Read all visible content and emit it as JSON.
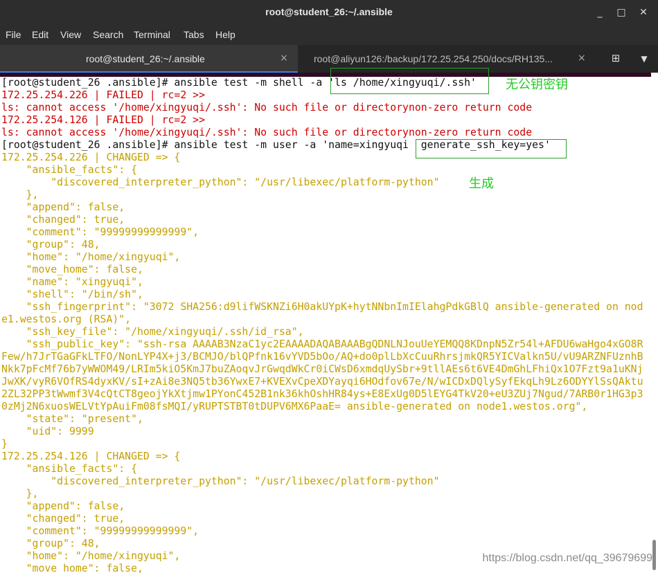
{
  "window": {
    "title": "root@student_26:~/.ansible",
    "minimize_icon": "minimize-icon",
    "maximize_icon": "maximize-icon",
    "close_icon": "close-icon"
  },
  "menu": [
    "File",
    "Edit",
    "View",
    "Search",
    "Terminal",
    "Tabs",
    "Help"
  ],
  "tabs": [
    {
      "label": "root@student_26:~/.ansible",
      "active": true,
      "close": "×"
    },
    {
      "label": "root@aliyun126:/backup/172.25.254.250/docs/RH135...",
      "active": false,
      "close": "×"
    }
  ],
  "tab_actions": {
    "new_tab_icon": "new-tab-icon",
    "menu_icon": "chevron-down-icon"
  },
  "colors": {
    "prompt": "#111111",
    "error": "#cc0000",
    "output": "#c4a000",
    "annotation": "#22cc22",
    "box": "#2e9e2e"
  },
  "terminal": {
    "lines": [
      {
        "t": "[root@student_26 .ansible]# ansible test -m shell -a 'ls /home/xingyuqi/.ssh'",
        "c": "dark"
      },
      {
        "t": "172.25.254.226 | FAILED | rc=2 >>",
        "c": "red"
      },
      {
        "t": "ls: cannot access '/home/xingyuqi/.ssh': No such file or directorynon-zero return code",
        "c": "red"
      },
      {
        "t": "172.25.254.126 | FAILED | rc=2 >>",
        "c": "red"
      },
      {
        "t": "ls: cannot access '/home/xingyuqi/.ssh': No such file or directorynon-zero return code",
        "c": "red"
      },
      {
        "t": "[root@student_26 .ansible]# ansible test -m user -a 'name=xingyuqi  generate_ssh_key=yes'",
        "c": "dark"
      },
      {
        "t": "172.25.254.226 | CHANGED => {",
        "c": "gold"
      },
      {
        "t": "    \"ansible_facts\": {",
        "c": "gold"
      },
      {
        "t": "        \"discovered_interpreter_python\": \"/usr/libexec/platform-python\"",
        "c": "gold"
      },
      {
        "t": "    },",
        "c": "gold"
      },
      {
        "t": "    \"append\": false,",
        "c": "gold"
      },
      {
        "t": "    \"changed\": true,",
        "c": "gold"
      },
      {
        "t": "    \"comment\": \"99999999999999\",",
        "c": "gold"
      },
      {
        "t": "    \"group\": 48,",
        "c": "gold"
      },
      {
        "t": "    \"home\": \"/home/xingyuqi\",",
        "c": "gold"
      },
      {
        "t": "    \"move_home\": false,",
        "c": "gold"
      },
      {
        "t": "    \"name\": \"xingyuqi\",",
        "c": "gold"
      },
      {
        "t": "    \"shell\": \"/bin/sh\",",
        "c": "gold"
      },
      {
        "t": "    \"ssh_fingerprint\": \"3072 SHA256:d9lifWSKNZi6H0akUYpK+hytNNbnImIElahgPdkGBlQ ansible-generated on nod",
        "c": "gold"
      },
      {
        "t": "e1.westos.org (RSA)\",",
        "c": "gold"
      },
      {
        "t": "    \"ssh_key_file\": \"/home/xingyuqi/.ssh/id_rsa\",",
        "c": "gold"
      },
      {
        "t": "    \"ssh_public_key\": \"ssh-rsa AAAAB3NzaC1yc2EAAAADAQABAAABgQDNLNJouUeYEMQQ8KDnpN5Zr54l+AFDU6waHgo4xGO8R",
        "c": "gold"
      },
      {
        "t": "Few/h7JrTGaGFkLTFO/NonLYP4X+j3/BCMJO/blQPfnk16vYVD5bOo/AQ+do0plLbXcCuuRhrsjmkQR5YICValkn5U/vU9ARZNFUznhB",
        "c": "gold"
      },
      {
        "t": "Nkk7pFcMf76b7yWWOM49/LRIm5kiO5KmJ7buZAoqvJrGwqdWkCr0iCWsD6xmdqUySbr+9tllAEs6t6VE4DmGhLFhiQx1O7Fzt9a1uKNj",
        "c": "gold"
      },
      {
        "t": "JwXK/vyR6VOfRS4dyxKV/sI+zAi8e3NQ5tb36YwxE7+KVEXvCpeXDYayqi6HOdfov67e/N/wICDxDQlySyfEkqLh9Lz6ODYYlSsQAktu",
        "c": "gold"
      },
      {
        "t": "2ZL32PP3tWwmf3V4cQtCT8geojYkXtjmw1PYonC452B1nk36khOshHR84ys+E8ExUg0D5lEYG4TkV20+eU3ZUj7Ngud/7ARB0r1HG3p3",
        "c": "gold"
      },
      {
        "t": "0zMj2N6xuosWELVtYpAuiFm08fsMQI/yRUPTSTBT0tDUPV6MX6PaaE= ansible-generated on node1.westos.org\",",
        "c": "gold"
      },
      {
        "t": "    \"state\": \"present\",",
        "c": "gold"
      },
      {
        "t": "    \"uid\": 9999",
        "c": "gold"
      },
      {
        "t": "}",
        "c": "gold"
      },
      {
        "t": "172.25.254.126 | CHANGED => {",
        "c": "gold"
      },
      {
        "t": "    \"ansible_facts\": {",
        "c": "gold"
      },
      {
        "t": "        \"discovered_interpreter_python\": \"/usr/libexec/platform-python\"",
        "c": "gold"
      },
      {
        "t": "    },",
        "c": "gold"
      },
      {
        "t": "    \"append\": false,",
        "c": "gold"
      },
      {
        "t": "    \"changed\": true,",
        "c": "gold"
      },
      {
        "t": "    \"comment\": \"99999999999999\",",
        "c": "gold"
      },
      {
        "t": "    \"group\": 48,",
        "c": "gold"
      },
      {
        "t": "    \"home\": \"/home/xingyuqi\",",
        "c": "gold"
      },
      {
        "t": "    \"move_home\": false,",
        "c": "gold"
      }
    ]
  },
  "annotations": {
    "note1": "无公钥密钥",
    "note2": "生成"
  },
  "watermark": "https://blog.csdn.net/qq_39679699"
}
